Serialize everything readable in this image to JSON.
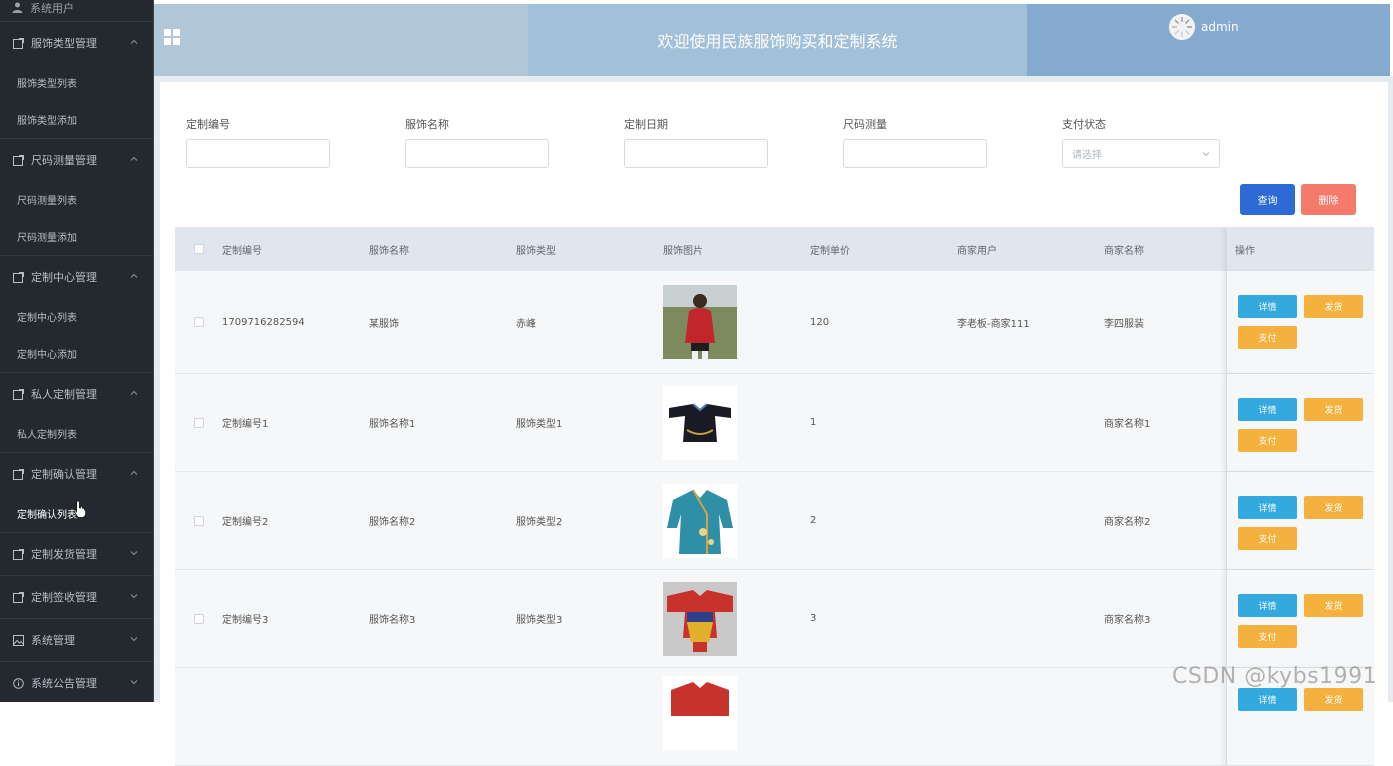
{
  "sidebar": {
    "partial_top": "系统用户",
    "groups": [
      {
        "title": "服饰类型管理",
        "items": [
          "服饰类型列表",
          "服饰类型添加"
        ]
      },
      {
        "title": "尺码测量管理",
        "items": [
          "尺码测量列表",
          "尺码测量添加"
        ]
      },
      {
        "title": "定制中心管理",
        "items": [
          "定制中心列表",
          "定制中心添加"
        ]
      },
      {
        "title": "私人定制管理",
        "items": [
          "私人定制列表"
        ]
      },
      {
        "title": "定制确认管理",
        "items": [
          "定制确认列表"
        ]
      },
      {
        "title": "定制发货管理",
        "items": []
      },
      {
        "title": "定制签收管理",
        "items": []
      },
      {
        "title": "系统管理",
        "items": []
      },
      {
        "title": "系统公告管理",
        "items": []
      }
    ]
  },
  "header": {
    "title": "欢迎使用民族服饰购买和定制系统",
    "user": "admin"
  },
  "search": {
    "fields": [
      {
        "label": "定制编号",
        "value": ""
      },
      {
        "label": "服饰名称",
        "value": ""
      },
      {
        "label": "定制日期",
        "value": ""
      },
      {
        "label": "尺码测量",
        "value": ""
      }
    ],
    "pay_status_label": "支付状态",
    "pay_status_placeholder": "请选择",
    "query_label": "查询",
    "delete_label": "删除"
  },
  "table": {
    "headers": [
      "定制编号",
      "服饰名称",
      "服饰类型",
      "服饰图片",
      "定制单价",
      "商家用户",
      "商家名称",
      "操作"
    ],
    "rows": [
      {
        "code": "1709716282594",
        "name": "某服饰",
        "type": "赤峰",
        "price": "120",
        "merchant_user": "李老板-商家111",
        "merchant_name": "李四服装"
      },
      {
        "code": "定制编号1",
        "name": "服饰名称1",
        "type": "服饰类型1",
        "price": "1",
        "merchant_user": "",
        "merchant_name": "商家名称1"
      },
      {
        "code": "定制编号2",
        "name": "服饰名称2",
        "type": "服饰类型2",
        "price": "2",
        "merchant_user": "",
        "merchant_name": "商家名称2"
      },
      {
        "code": "定制编号3",
        "name": "服饰名称3",
        "type": "服饰类型3",
        "price": "3",
        "merchant_user": "",
        "merchant_name": "商家名称3"
      }
    ],
    "actions": {
      "detail": "详情",
      "ship": "发货",
      "pay": "支付"
    }
  },
  "watermark": "CSDN @kybs1991"
}
